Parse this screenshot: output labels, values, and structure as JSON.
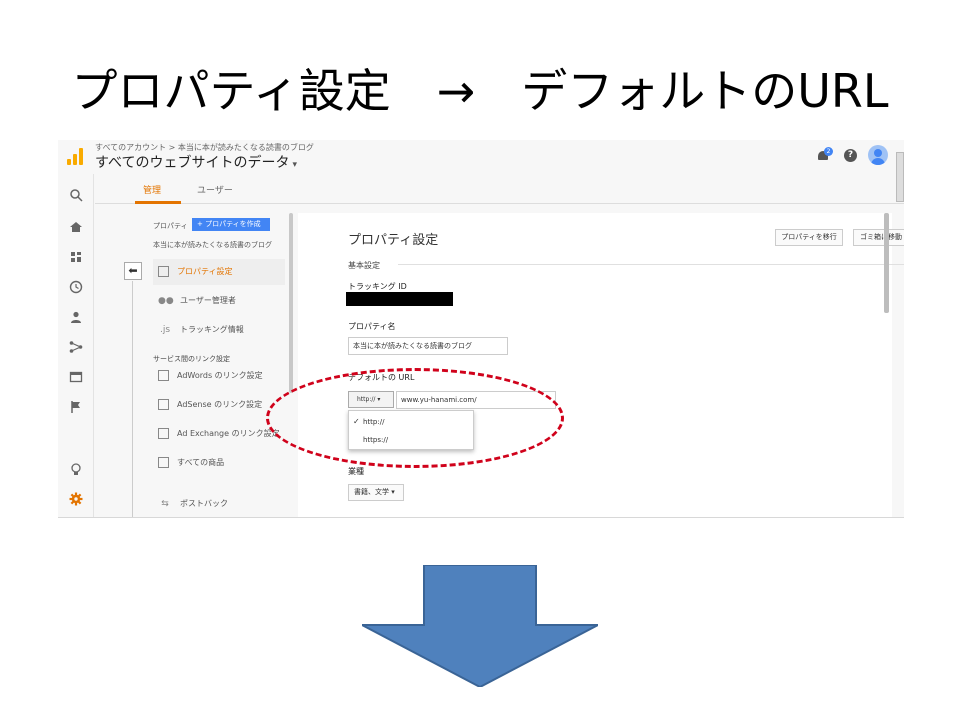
{
  "slide": {
    "title": "プロパティ設定　→　デフォルトのURL"
  },
  "header": {
    "breadcrumb": "すべてのアカウント > 本当に本が読みたくなる読書のブログ",
    "account_view": "すべてのウェブサイトのデータ",
    "caret": "▾",
    "notification_count": "2",
    "help_glyph": "?"
  },
  "tabs": [
    {
      "label": "管理",
      "active": true
    },
    {
      "label": "ユーザー",
      "active": false
    }
  ],
  "property_column": {
    "label": "プロパティ",
    "create_button": "+ プロパティを作成",
    "property_name": "本当に本が読みたくなる読書のブログ",
    "back_glyph": "⬅",
    "items": [
      {
        "label": "プロパティ設定",
        "icon": "settings-page-icon",
        "selected": true
      },
      {
        "label": "ユーザー管理者",
        "icon": "users-icon",
        "selected": false
      },
      {
        "label": "トラッキング情報",
        "icon": "js-icon",
        "selected": false
      }
    ],
    "section_heading": "サービス間のリンク設定",
    "link_items": [
      {
        "label": "AdWords のリンク設定",
        "icon": "adwords-icon"
      },
      {
        "label": "AdSense のリンク設定",
        "icon": "adsense-icon"
      },
      {
        "label": "Ad Exchange のリンク設定",
        "icon": "ad-exchange-icon"
      },
      {
        "label": "すべての商品",
        "icon": "all-products-icon"
      },
      {
        "label": "ポストバック",
        "icon": "postback-icon"
      }
    ],
    "js_glyph": ".js"
  },
  "panel": {
    "title": "プロパティ設定",
    "move_button": "プロパティを移行",
    "trash_button": "ゴミ箱に移動",
    "section_basic": "基本設定",
    "tracking_id_label": "トラッキング ID",
    "property_name_label": "プロパティ名",
    "property_name_value": "本当に本が読みたくなる読書のブログ",
    "default_url_label": "デフォルトの URL",
    "protocol_selected": "http://",
    "url_value": "www.yu-hanami.com/",
    "protocol_options": [
      {
        "label": "http://",
        "checked": true
      },
      {
        "label": "https://",
        "checked": false
      }
    ],
    "check_glyph": "✓",
    "industry_label": "業種",
    "industry_value": "書籍、文学"
  },
  "colors": {
    "accent_orange": "#e37400",
    "primary_blue": "#4285f4",
    "highlight_red": "#d0021b",
    "arrow_blue": "#4f81bd"
  }
}
